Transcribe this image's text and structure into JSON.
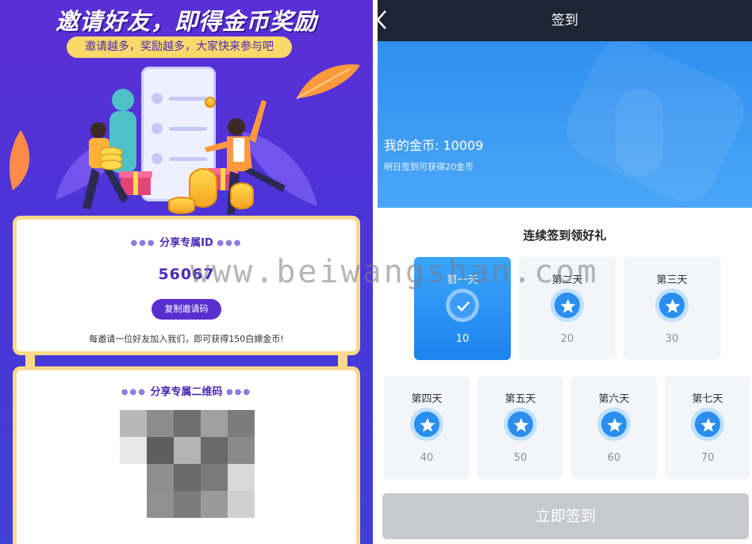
{
  "left": {
    "hero_title": "邀请好友，即得金币奖励",
    "hero_subtitle": "邀请越多，奖励越多，大家快来参与吧",
    "id_card": {
      "heading": "分享专属ID",
      "id_value": "56067",
      "copy_button": "复制邀请码",
      "note": "每邀请一位好友加入我们，即可获得150白嫖金币!"
    },
    "qr_card": {
      "heading": "分享专属二维码"
    }
  },
  "right": {
    "title": "签到",
    "my_coins_label": "我的金币: 10009",
    "tomorrow_tip": "明日签到可获得20金币",
    "section_title": "连续签到领好礼",
    "days": [
      {
        "label": "第一天",
        "value": "10",
        "checked": true
      },
      {
        "label": "第二天",
        "value": "20",
        "checked": false
      },
      {
        "label": "第三天",
        "value": "30",
        "checked": false
      },
      {
        "label": "第四天",
        "value": "40",
        "checked": false
      },
      {
        "label": "第五天",
        "value": "50",
        "checked": false
      },
      {
        "label": "第六天",
        "value": "60",
        "checked": false
      },
      {
        "label": "第七天",
        "value": "70",
        "checked": false
      }
    ],
    "signin_button": "立即签到"
  },
  "watermark": "www.beiwangshan.com",
  "colors": {
    "purple": "#5a2fd0",
    "gold": "#fbd98a",
    "blue": "#2a8ef0",
    "topbar": "#1d2433",
    "button_disabled": "#c7c9cd"
  }
}
